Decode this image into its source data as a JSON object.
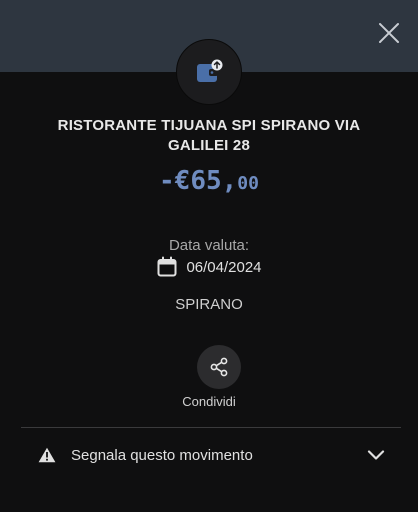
{
  "header": {
    "close_icon": "close-icon"
  },
  "merchant": {
    "icon": "wallet-transfer-icon",
    "name": "RISTORANTE TIJUANA SPI SPIRANO VIA GALILEI 28"
  },
  "amount": {
    "integer_part": "-€65,",
    "decimal_part": "00",
    "color": "#6f8cc0"
  },
  "value_date": {
    "label": "Data valuta:",
    "icon": "calendar-icon",
    "date": "06/04/2024"
  },
  "location": {
    "city": "SPIRANO"
  },
  "share": {
    "icon": "share-icon",
    "label": "Condividi"
  },
  "report": {
    "icon": "warning-icon",
    "label": "Segnala questo movimento",
    "chevron_icon": "chevron-down-icon"
  },
  "colors": {
    "top_band": "#2e3640",
    "background": "#0f0f10",
    "icon_circle": "#1c1c1e",
    "icon_accent": "#4a6fa8"
  }
}
